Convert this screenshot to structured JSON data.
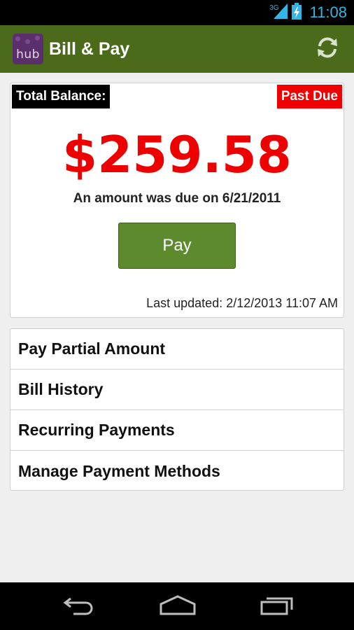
{
  "status_bar": {
    "network": "3G",
    "time": "11:08"
  },
  "action_bar": {
    "logo_text": "hub",
    "title": "Bill & Pay",
    "refresh_icon": "refresh-icon"
  },
  "balance": {
    "total_label": "Total Balance:",
    "status_badge": "Past Due",
    "amount": "$259.58",
    "due_text": "An amount was due on 6/21/2011",
    "pay_label": "Pay",
    "last_updated": "Last updated: 2/12/2013 11:07 AM"
  },
  "menu": {
    "items": [
      {
        "label": "Pay Partial Amount"
      },
      {
        "label": "Bill History"
      },
      {
        "label": "Recurring Payments"
      },
      {
        "label": "Manage Payment Methods"
      }
    ]
  },
  "nav": {
    "back_icon": "back-icon",
    "home_icon": "home-icon",
    "recents_icon": "recents-icon"
  },
  "colors": {
    "action_bar": "#4b6a1a",
    "amount": "#ee0000",
    "past_due": "#f00000",
    "pay_button": "#5e8a2e",
    "status_accent": "#33b5e5"
  }
}
